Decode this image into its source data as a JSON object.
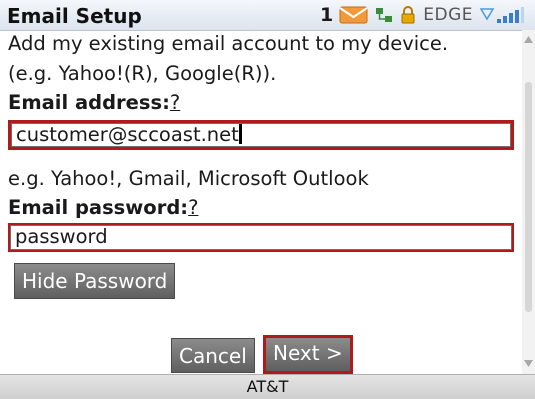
{
  "title_bar": {
    "title": "Email Setup",
    "unread_count": "1",
    "network_type": "EDGE"
  },
  "content": {
    "intro_line1": "Add my existing email account to my device.",
    "intro_line2": "(e.g. Yahoo!(R), Google(R)).",
    "email_label": "Email address:",
    "help_marker": "?",
    "email_value": "customer@sccoast.net",
    "email_hint": "e.g. Yahoo!, Gmail, Microsoft Outlook",
    "password_label": "Email password:",
    "password_value": "password"
  },
  "buttons": {
    "hide_password": "Hide Password",
    "cancel": "Cancel",
    "next": "Next >"
  },
  "footer": {
    "carrier": "AT&T"
  },
  "colors": {
    "focus_border": "#b11a1a",
    "button_bg": "#6f6f6f",
    "title_bar_bg": "#e6ebf2"
  },
  "icons": [
    "envelope-icon",
    "network-icon",
    "lock-icon",
    "signal-strength-icon"
  ]
}
